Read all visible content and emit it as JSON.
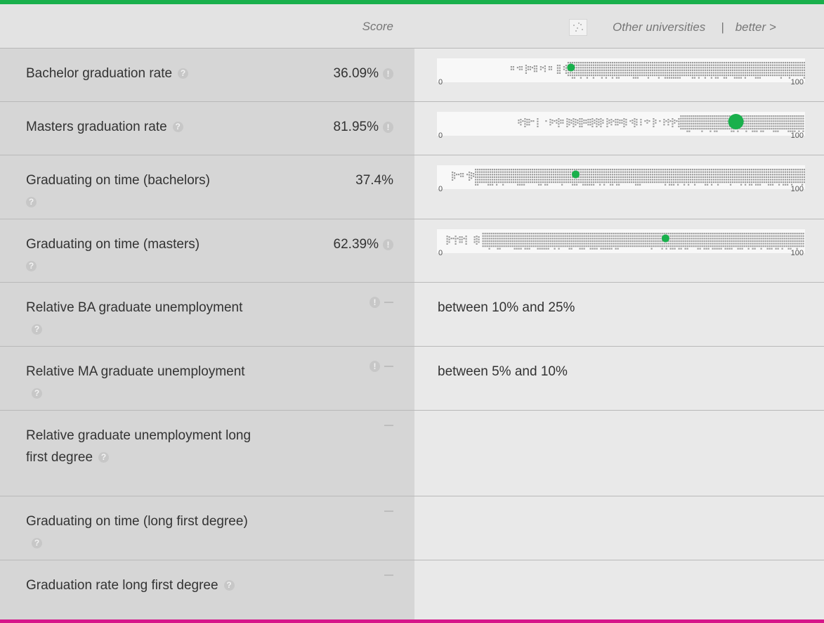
{
  "header": {
    "score_label": "Score",
    "legend_label": "Other universities",
    "separator": "|",
    "better_label": "better >"
  },
  "icons": {
    "help": "question-mark-icon",
    "warning": "exclamation-icon",
    "no_value": "dash-icon"
  },
  "colors": {
    "highlight": "#19b04c",
    "others": "#9e9e9e",
    "top_accent": "#19b04c",
    "bottom_accent": "#d6168a"
  },
  "axis": {
    "min_label": "0",
    "max_label": "100"
  },
  "rows": [
    {
      "label": "Bachelor graduation rate",
      "score": "36.09%",
      "has_warning": true,
      "chart_value": 36.09
    },
    {
      "label": "Masters graduation rate",
      "score": "81.95%",
      "has_warning": true,
      "chart_value": 81.95
    },
    {
      "label": "Graduating on time (bachelors)",
      "score": "37.4%",
      "has_warning": false,
      "chart_value": 37.4
    },
    {
      "label": "Graduating on time (masters)",
      "score": "62.39%",
      "has_warning": true,
      "chart_value": 62.39
    },
    {
      "label": "Relative BA graduate unemployment",
      "score": "",
      "has_warning": true,
      "value_text": "between 10% and 25%"
    },
    {
      "label": "Relative MA graduate unemployment",
      "score": "",
      "has_warning": true,
      "value_text": "between 5% and 10%"
    },
    {
      "label": "Relative graduate unemployment long first degree",
      "score": "",
      "has_warning": false,
      "value_text": ""
    },
    {
      "label": "Graduating on time (long first degree)",
      "score": "",
      "has_warning": false,
      "value_text": ""
    },
    {
      "label": "Graduation rate long first degree",
      "score": "",
      "has_warning": false,
      "value_text": ""
    }
  ]
}
